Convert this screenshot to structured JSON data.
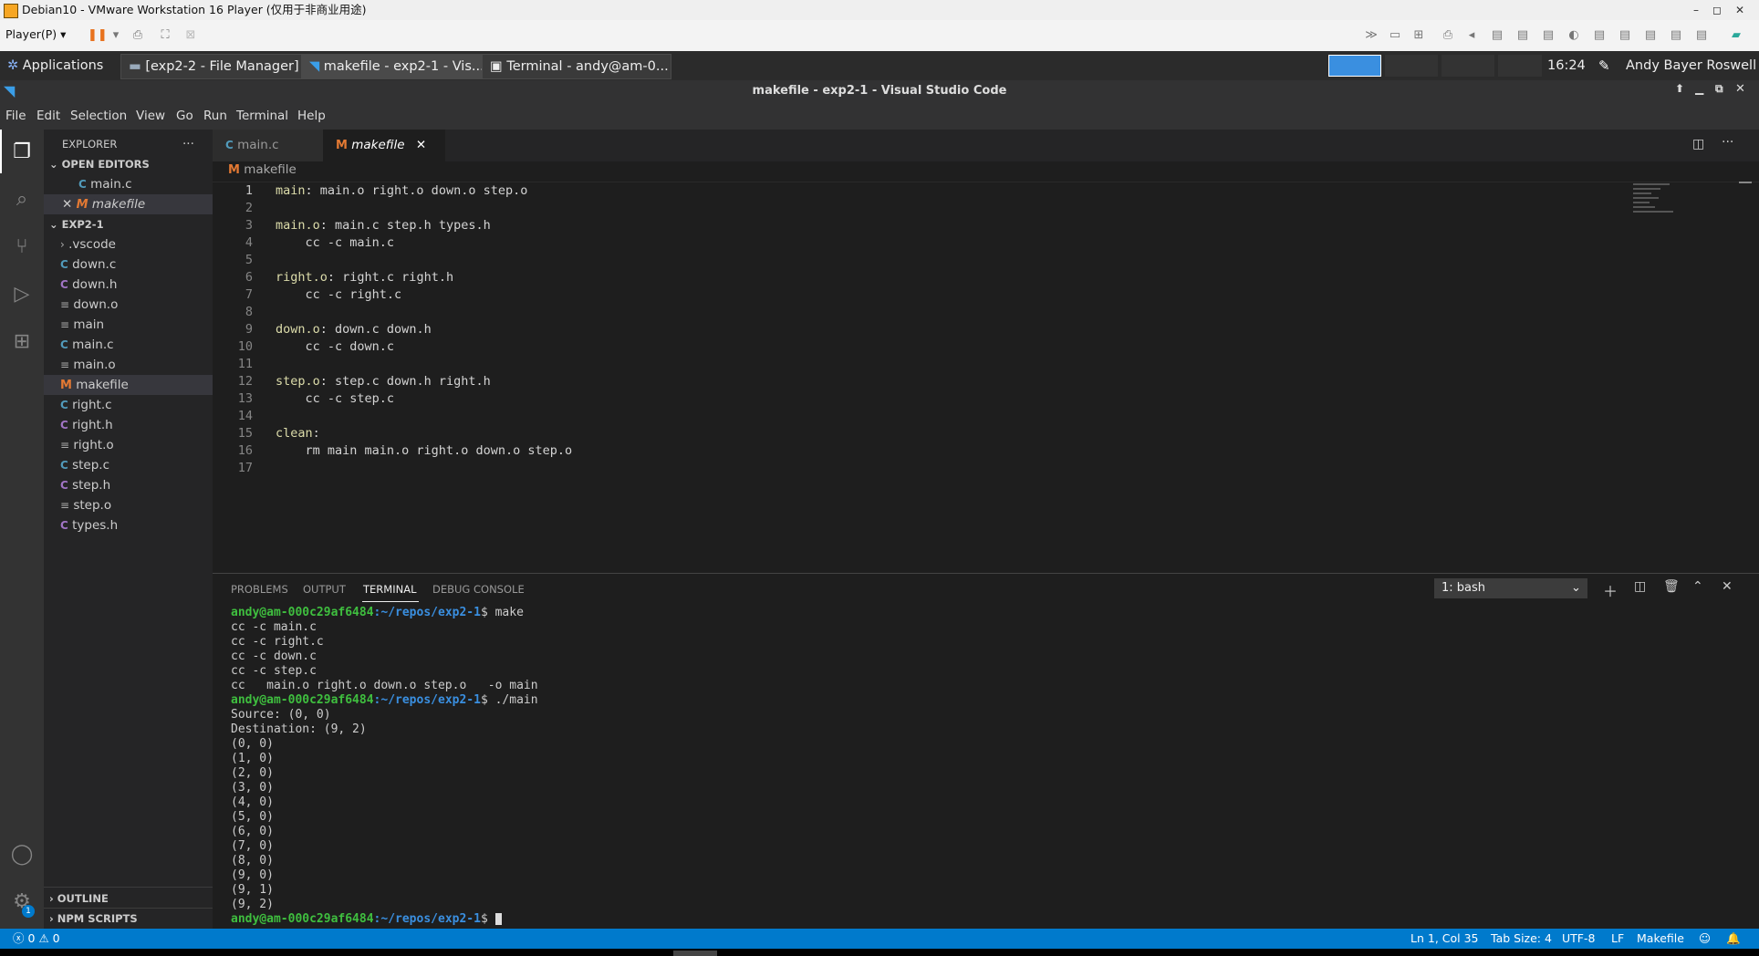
{
  "vm": {
    "title": "Debian10 - VMware Workstation 16 Player (仅用于非商业用途)",
    "player_menu": "Player(P)",
    "ctrl_min": "–",
    "ctrl_max": "◻",
    "ctrl_close": "✕"
  },
  "panel": {
    "applications": "Applications",
    "tasks": [
      "[exp2-2 - File Manager]",
      "makefile - exp2-1 - Vis...",
      "Terminal - andy@am-0..."
    ],
    "clock": "16:24",
    "user": "Andy Bayer Roswell"
  },
  "vscode": {
    "title": "makefile - exp2-1 - Visual Studio Code",
    "menu": [
      "File",
      "Edit",
      "Selection",
      "View",
      "Go",
      "Run",
      "Terminal",
      "Help"
    ]
  },
  "sidebar": {
    "explorer": "EXPLORER",
    "open_editors": "OPEN EDITORS",
    "open_files": [
      "main.c",
      "makefile"
    ],
    "project": "EXP2-1",
    "files": [
      {
        "name": ".vscode",
        "icon": ">"
      },
      {
        "name": "down.c",
        "icon": "C"
      },
      {
        "name": "down.h",
        "icon": "C"
      },
      {
        "name": "down.o",
        "icon": "≡"
      },
      {
        "name": "main",
        "icon": "≡"
      },
      {
        "name": "main.c",
        "icon": "C"
      },
      {
        "name": "main.o",
        "icon": "≡"
      },
      {
        "name": "makefile",
        "icon": "M"
      },
      {
        "name": "right.c",
        "icon": "C"
      },
      {
        "name": "right.h",
        "icon": "C"
      },
      {
        "name": "right.o",
        "icon": "≡"
      },
      {
        "name": "step.c",
        "icon": "C"
      },
      {
        "name": "step.h",
        "icon": "C"
      },
      {
        "name": "step.o",
        "icon": "≡"
      },
      {
        "name": "types.h",
        "icon": "C"
      }
    ],
    "outline": "OUTLINE",
    "npm_scripts": "NPM SCRIPTS"
  },
  "editor": {
    "tabs": [
      "main.c",
      "makefile"
    ],
    "breadcrumb": "makefile",
    "lines": [
      "main: main.o right.o down.o step.o",
      "",
      "main.o: main.c step.h types.h",
      "    cc -c main.c",
      "",
      "right.o: right.c right.h",
      "    cc -c right.c",
      "",
      "down.o: down.c down.h",
      "    cc -c down.c",
      "",
      "step.o: step.c down.h right.h",
      "    cc -c step.c",
      "",
      "clean:",
      "    rm main main.o right.o down.o step.o",
      ""
    ]
  },
  "terminal": {
    "tabs": [
      "PROBLEMS",
      "OUTPUT",
      "TERMINAL",
      "DEBUG CONSOLE"
    ],
    "shell": "1: bash",
    "prompt_user": "andy@am-000c29af6484",
    "prompt_path": ":~/repos/exp2-1",
    "lines": [
      {
        "type": "prompt",
        "cmd": " make"
      },
      {
        "type": "out",
        "text": "cc -c main.c"
      },
      {
        "type": "out",
        "text": "cc -c right.c"
      },
      {
        "type": "out",
        "text": "cc -c down.c"
      },
      {
        "type": "out",
        "text": "cc -c step.c"
      },
      {
        "type": "out",
        "text": "cc   main.o right.o down.o step.o   -o main"
      },
      {
        "type": "prompt",
        "cmd": " ./main"
      },
      {
        "type": "out",
        "text": "Source: (0, 0)"
      },
      {
        "type": "out",
        "text": "Destination: (9, 2)"
      },
      {
        "type": "out",
        "text": "(0, 0)"
      },
      {
        "type": "out",
        "text": "(1, 0)"
      },
      {
        "type": "out",
        "text": "(2, 0)"
      },
      {
        "type": "out",
        "text": "(3, 0)"
      },
      {
        "type": "out",
        "text": "(4, 0)"
      },
      {
        "type": "out",
        "text": "(5, 0)"
      },
      {
        "type": "out",
        "text": "(6, 0)"
      },
      {
        "type": "out",
        "text": "(7, 0)"
      },
      {
        "type": "out",
        "text": "(8, 0)"
      },
      {
        "type": "out",
        "text": "(9, 0)"
      },
      {
        "type": "out",
        "text": "(9, 1)"
      },
      {
        "type": "out",
        "text": "(9, 2)"
      },
      {
        "type": "prompt",
        "cmd": " "
      }
    ]
  },
  "status": {
    "errors": "0",
    "warnings": "0",
    "position": "Ln 1, Col 35",
    "tab_size": "Tab Size: 4",
    "encoding": "UTF-8",
    "eol": "LF",
    "language": "Makefile"
  },
  "colors": {
    "accent": "#007acc",
    "prompt_green": "#3fbf3f",
    "prompt_blue": "#3a8fe0"
  }
}
